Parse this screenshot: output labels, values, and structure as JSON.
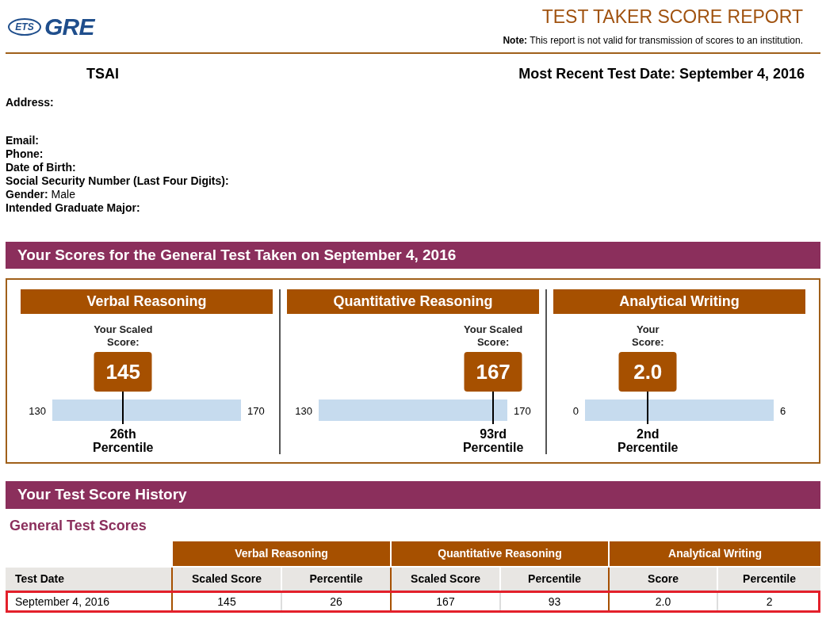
{
  "header": {
    "logo_left": "ETS",
    "logo_right": "GRE",
    "title": "TEST TAKER SCORE REPORT",
    "note_label": "Note:",
    "note": "This report is not valid for transmission of scores to an institution."
  },
  "candidate": {
    "name": "TSAI",
    "recent_test": "Most Recent Test Date: September 4, 2016"
  },
  "field_groups": [
    [
      {
        "label": "Address:"
      }
    ],
    [
      {
        "label": "Email:"
      },
      {
        "label": "Phone:"
      },
      {
        "label": "Date of Birth:"
      },
      {
        "label": "Social Security Number (Last Four Digits):"
      },
      {
        "label": "Gender:",
        "value": "Male"
      },
      {
        "label": "Intended Graduate Major:"
      }
    ]
  ],
  "scores_banner": "Your Scores for the General Test Taken on September 4, 2016",
  "scores": [
    {
      "title": "Verbal Reasoning",
      "caption": "Your Scaled\nScore:",
      "score": "145",
      "min": "130",
      "max": "170",
      "level": 0.375,
      "percentile": "26th Percentile"
    },
    {
      "title": "Quantitative Reasoning",
      "caption": "Your Scaled\nScore:",
      "score": "167",
      "min": "130",
      "max": "170",
      "level": 0.925,
      "percentile": "93rd Percentile"
    },
    {
      "title": "Analytical Writing",
      "caption": "Your\nScore:",
      "score": "2.0",
      "min": "0",
      "max": "6",
      "level": 0.333,
      "percentile": "2nd Percentile"
    }
  ],
  "history_banner": "Your Test Score History",
  "history": {
    "subtitle": "General Test Scores",
    "groups": [
      "Verbal Reasoning",
      "Quantitative Reasoning",
      "Analytical Writing"
    ],
    "columns": [
      "Test Date",
      "Scaled Score",
      "Percentile",
      "Scaled Score",
      "Percentile",
      "Score",
      "Percentile"
    ],
    "rows": [
      {
        "cells": [
          "September 4, 2016",
          "145",
          "26",
          "167",
          "93",
          "2.0",
          "2"
        ],
        "highlighted": true
      }
    ]
  }
}
